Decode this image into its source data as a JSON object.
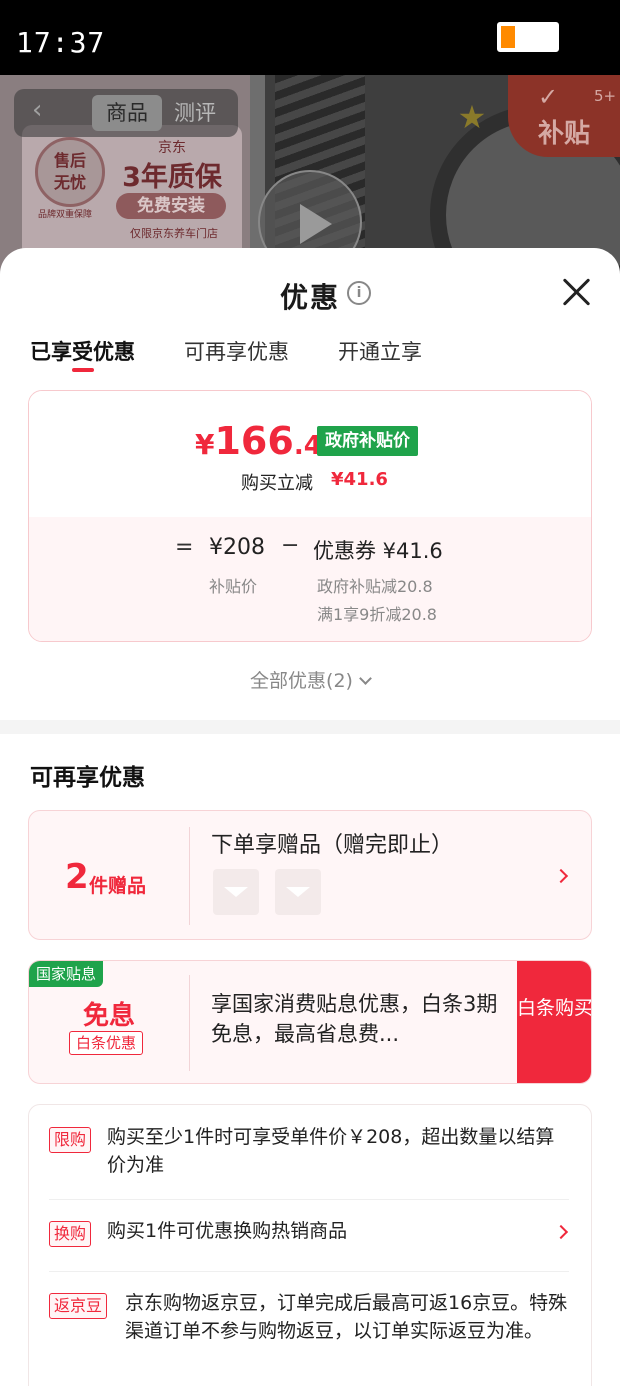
{
  "status_bar": {
    "time": "17:37"
  },
  "background_page": {
    "tabs": [
      "商品",
      "测评"
    ],
    "promo_badge_lines": [
      "售后",
      "无忧"
    ],
    "promo_brand": "京东",
    "promo_headline": "3年质保",
    "promo_button": "免费安装",
    "promo_note": "仅限京东养车门店",
    "promo_small": "品牌双重保障",
    "subsidy_tag": {
      "label": "补贴",
      "count": "5+"
    }
  },
  "sheet": {
    "title": "优惠",
    "tabs": [
      {
        "label": "已享受优惠",
        "active": true
      },
      {
        "label": "可再享优惠",
        "active": false
      },
      {
        "label": "开通立享",
        "active": false
      }
    ],
    "summary": {
      "price_symbol": "¥",
      "price_int": "166",
      "price_dec": ".4",
      "gov_price_tag": "政府补贴价",
      "instant_label": "购买立减",
      "instant_amount": "¥41.6",
      "equals": "=",
      "base_price": "¥208",
      "minus": "−",
      "coupon": "优惠券 ¥41.6",
      "base_label": "补贴价",
      "deductions": [
        "政府补贴减20.8",
        "满1享9折减20.8"
      ]
    },
    "all_offers": "全部优惠(2)",
    "more_section_title": "可再享优惠",
    "gift_card": {
      "count": "2",
      "unit": "件赠品",
      "title": "下单享赠品（赠完即止）"
    },
    "interest_card": {
      "tag": "国家贴息",
      "headline": "免息",
      "sub_tag": "白条优惠",
      "text": "享国家消费贴息优惠，白条3期免息，最高省息费...",
      "button": "白条购买"
    },
    "rules": [
      {
        "tag": "限购",
        "text": "购买至少1件时可享受单件价￥208，超出数量以结算价为准",
        "has_arrow": false
      },
      {
        "tag": "换购",
        "text": "购买1件可优惠换购热销商品",
        "has_arrow": true
      },
      {
        "tag": "返京豆",
        "text": "京东购物返京豆，订单完成后最高可返16京豆。特殊渠道订单不参与购物返豆，以订单实际返豆为准。",
        "has_arrow": false
      }
    ]
  },
  "colors": {
    "accent": "#f0283c",
    "green_tag": "#1fa34b",
    "battery": "#ff8a00"
  }
}
